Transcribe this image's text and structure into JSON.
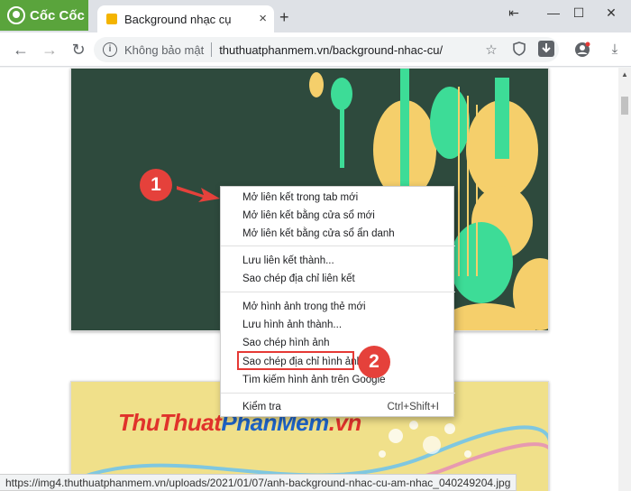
{
  "browser": {
    "brand": "Cốc Cốc",
    "tab_title": "Background nhạc cụ",
    "close_tab": "×",
    "new_tab": "+",
    "window_controls": {
      "restore": "⇤",
      "minimize": "—",
      "maximize": "☐",
      "close": "✕"
    }
  },
  "toolbar": {
    "security_label": "Không bảo mật",
    "url": "thuthuatphanmem.vn/background-nhac-cu/"
  },
  "page": {
    "watermark": {
      "part1": "ThuThuat",
      "part2": "PhanMem",
      "part3": ".vn"
    }
  },
  "context_menu": {
    "items": [
      {
        "label": "Mở liên kết trong tab mới"
      },
      {
        "label": "Mở liên kết bằng cửa sổ mới"
      },
      {
        "label": "Mở liên kết bằng cửa sổ ẩn danh"
      },
      {
        "label": "Lưu liên kết thành..."
      },
      {
        "label": "Sao chép địa chỉ liên kết"
      },
      {
        "label": "Mở hình ảnh trong thẻ mới"
      },
      {
        "label": "Lưu hình ảnh thành..."
      },
      {
        "label": "Sao chép hình ảnh"
      },
      {
        "label": "Sao chép địa chỉ hình ảnh"
      },
      {
        "label": "Tìm kiếm hình ảnh trên Google"
      },
      {
        "label": "Kiểm tra",
        "shortcut": "Ctrl+Shift+I"
      }
    ]
  },
  "annotations": {
    "step1": "1",
    "step2": "2"
  },
  "status_bar": {
    "url": "https://img4.thuthuatphanmem.vn/uploads/2021/01/07/anh-background-nhac-cu-am-nhac_040249204.jpg"
  },
  "colors": {
    "brand_green": "#5aa43c",
    "badge_red": "#e5413b",
    "image_bg": "#2e4a3d",
    "instrument_yellow": "#f5cf6b",
    "instrument_green": "#3ddc97",
    "watermark_red": "#e0322b",
    "watermark_blue": "#1e63c6"
  },
  "icons": [
    "back-icon",
    "forward-icon",
    "reload-icon",
    "info-icon",
    "star-icon",
    "shield-icon",
    "download-box-icon",
    "account-icon",
    "menu-icon",
    "arrow-icon"
  ]
}
